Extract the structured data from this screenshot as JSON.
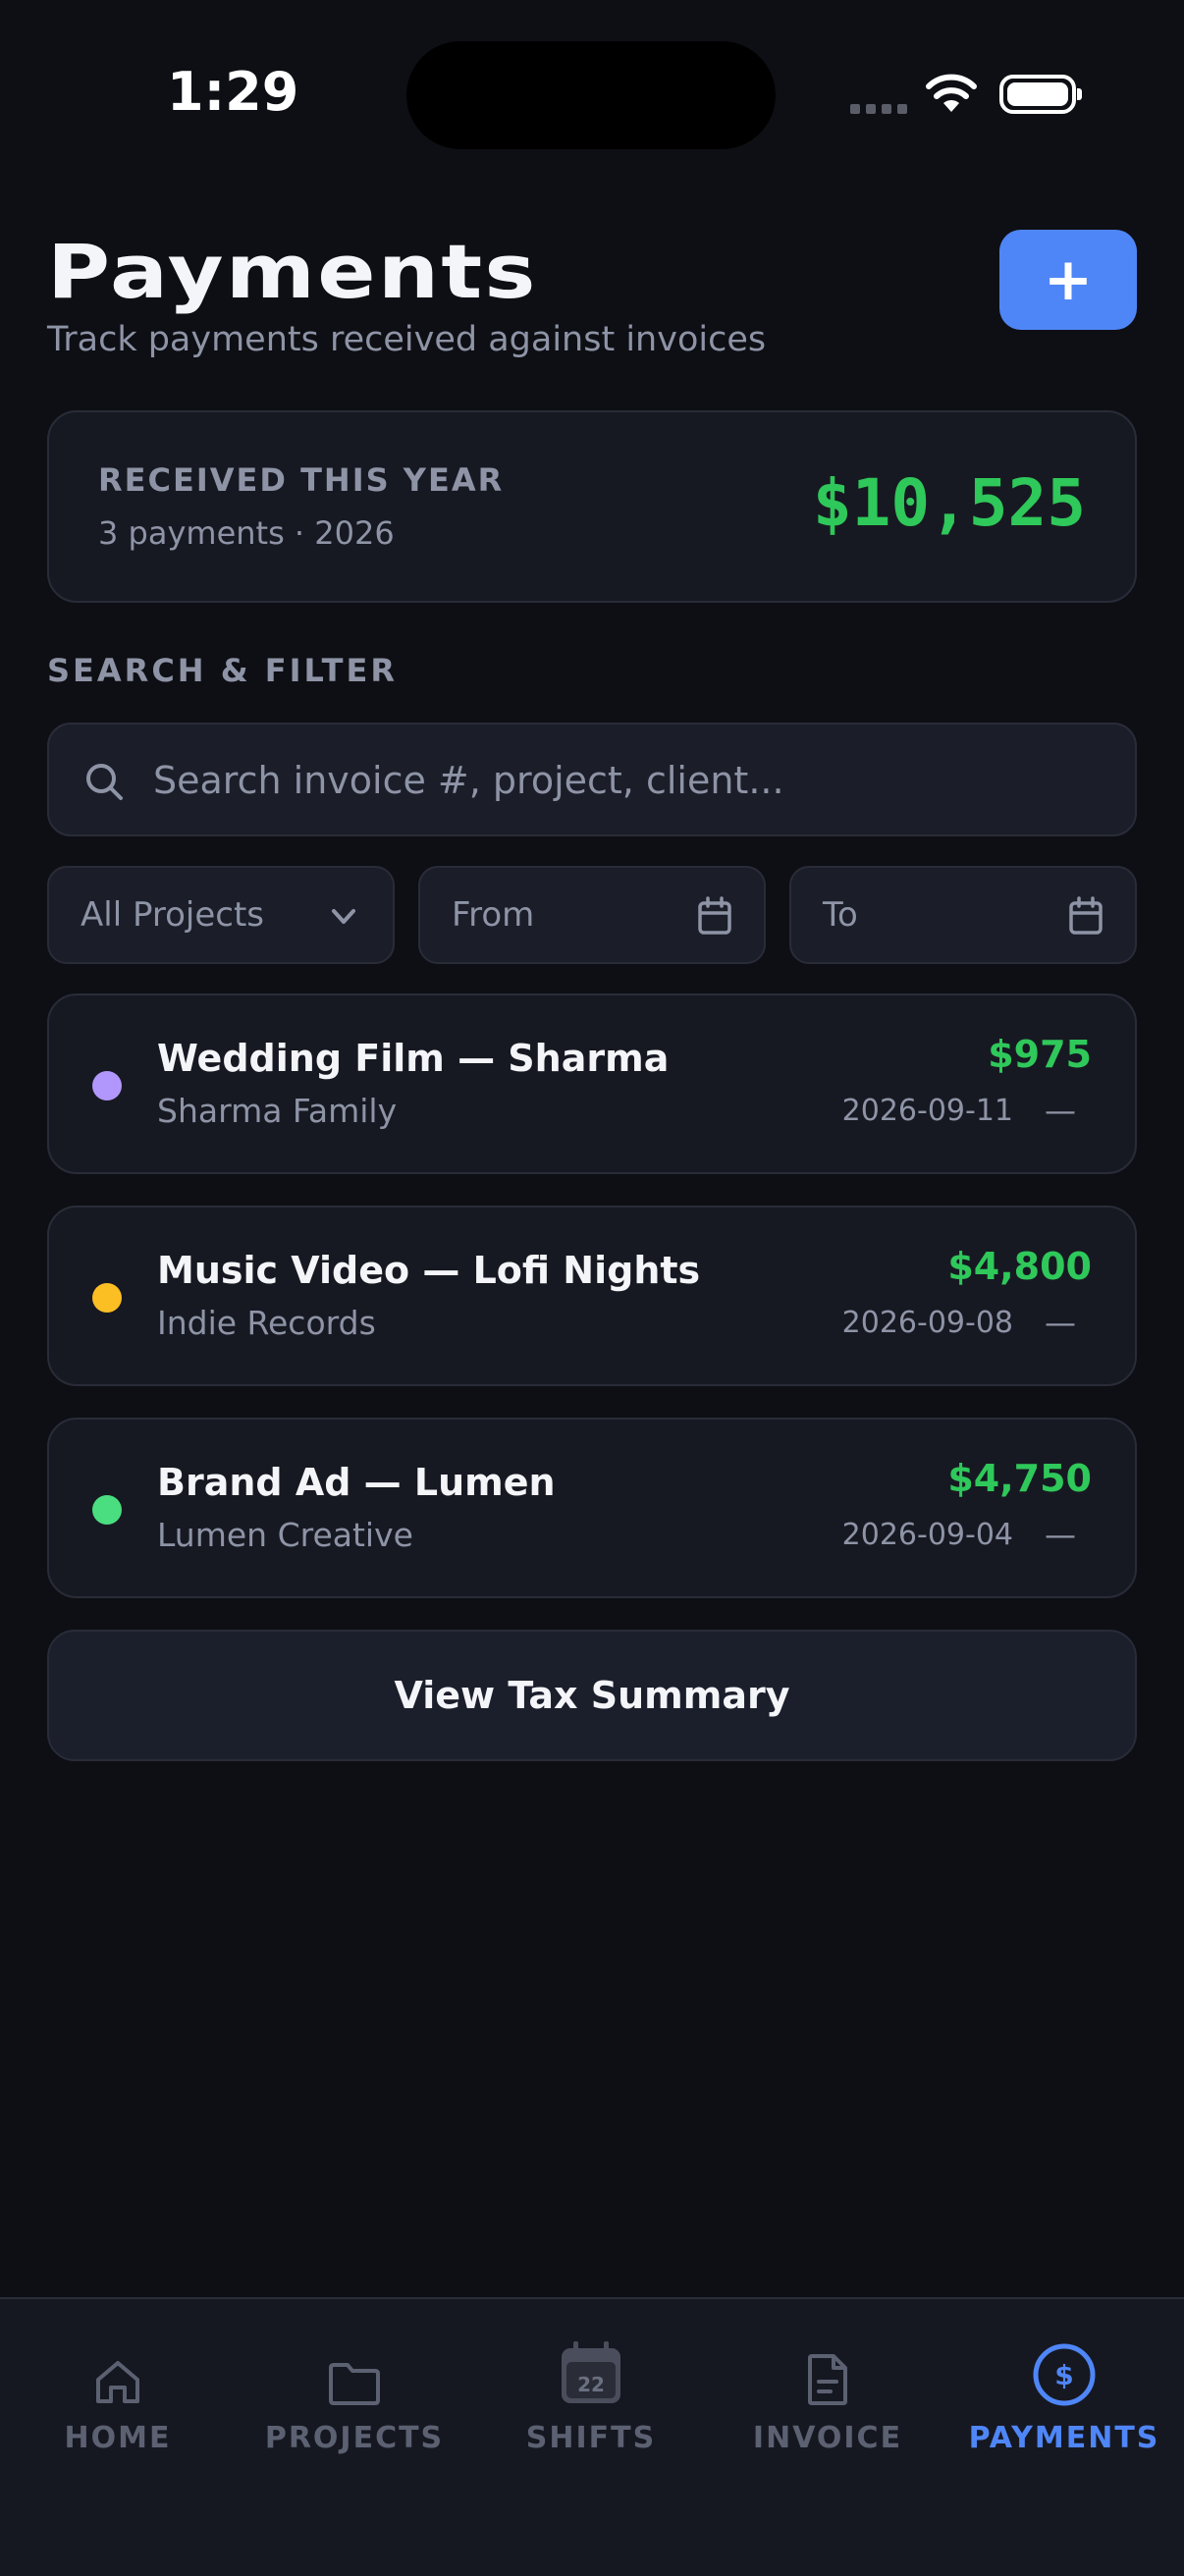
{
  "status_bar": {
    "time": "1:29"
  },
  "header": {
    "title": "Payments",
    "subtitle": "Track payments received against invoices",
    "add_button_label": "+"
  },
  "summary": {
    "label": "RECEIVED THIS YEAR",
    "meta": "3 payments · 2026",
    "total": "$10,525"
  },
  "filters": {
    "section_label": "SEARCH & FILTER",
    "search_placeholder": "Search invoice #, project, client...",
    "project_select": "All Projects",
    "from_label": "From",
    "to_label": "To"
  },
  "payments": [
    {
      "project": "Wedding Film — Sharma",
      "client": "Sharma Family",
      "amount": "$975",
      "date": "2026-09-11",
      "status": "—",
      "dot_color": "#b197fc"
    },
    {
      "project": "Music Video — Lofi Nights",
      "client": "Indie Records",
      "amount": "$4,800",
      "date": "2026-09-08",
      "status": "—",
      "dot_color": "#fbbf24"
    },
    {
      "project": "Brand Ad — Lumen",
      "client": "Lumen Creative",
      "amount": "$4,750",
      "date": "2026-09-04",
      "status": "—",
      "dot_color": "#4ade80"
    }
  ],
  "tax_button_label": "View Tax Summary",
  "tabs": [
    {
      "label": "HOME",
      "icon": "home-icon"
    },
    {
      "label": "PROJECTS",
      "icon": "folder-icon"
    },
    {
      "label": "SHIFTS",
      "icon": "calendar-icon",
      "calendar_day": "22"
    },
    {
      "label": "INVOICE",
      "icon": "document-icon"
    },
    {
      "label": "PAYMENTS",
      "icon": "dollar-icon",
      "active": true
    }
  ],
  "colors": {
    "accent": "#4f86f7",
    "money": "#2fc85a",
    "background": "#0e0f14"
  }
}
